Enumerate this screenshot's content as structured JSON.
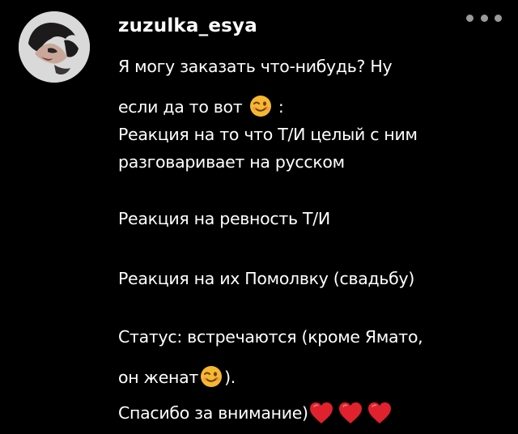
{
  "comment": {
    "username": "zuzulka_esya",
    "lines": [
      "Я могу заказать что-нибудь? Ну",
      "если да то вот",
      ":",
      "Реакция на то что Т/И целый с ним",
      "разговаривает на русском",
      "Реакция на ревность Т/И",
      "Реакция на их Помолвку (свадьбу)",
      "Статус: встречаются (кроме Ямато,",
      "он женат",
      ").",
      "Спасибо за внимание)"
    ]
  },
  "icons": {
    "more": "more-horizontal-icon",
    "wink": "winking-face-emoji",
    "heart": "red-heart-emoji"
  },
  "colors": {
    "background": "#000000",
    "text": "#ffffff",
    "more_dots": "#9a9a9a",
    "heart": "#e0212e",
    "emoji_face": "#f5b82e"
  }
}
